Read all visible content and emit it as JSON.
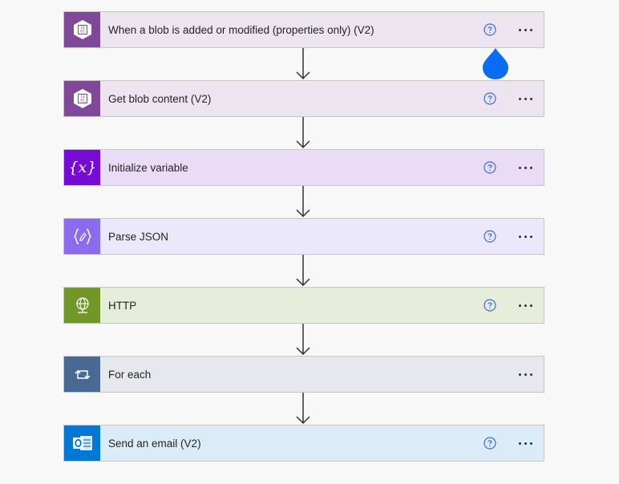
{
  "flow": {
    "steps": [
      {
        "id": "trigger",
        "title": "When a blob is added or modified (properties only) (V2)",
        "icon": "blob-storage-icon",
        "has_help": true
      },
      {
        "id": "get-blob",
        "title": "Get blob content (V2)",
        "icon": "blob-storage-icon",
        "has_help": true
      },
      {
        "id": "init-var",
        "title": "Initialize variable",
        "icon": "variable-icon",
        "has_help": true
      },
      {
        "id": "parse-json",
        "title": "Parse JSON",
        "icon": "parse-json-icon",
        "has_help": true
      },
      {
        "id": "http",
        "title": "HTTP",
        "icon": "globe-icon",
        "has_help": true
      },
      {
        "id": "for-each",
        "title": "For each",
        "icon": "loop-icon",
        "has_help": false
      },
      {
        "id": "send-email",
        "title": "Send an email (V2)",
        "icon": "outlook-icon",
        "has_help": true
      }
    ],
    "blob_icon_text": [
      "10",
      "01"
    ],
    "variable_icon_text": "{x}"
  },
  "colors": {
    "blob_tile": "#804998",
    "variable_tile": "#770bd6",
    "parse_json_tile": "#8b6cef",
    "http_tile": "#709727",
    "foreach_tile": "#486991",
    "outlook_tile": "#0078d4",
    "help_icon": "#3a6fe0",
    "drop_indicator": "#0a6cf0"
  }
}
